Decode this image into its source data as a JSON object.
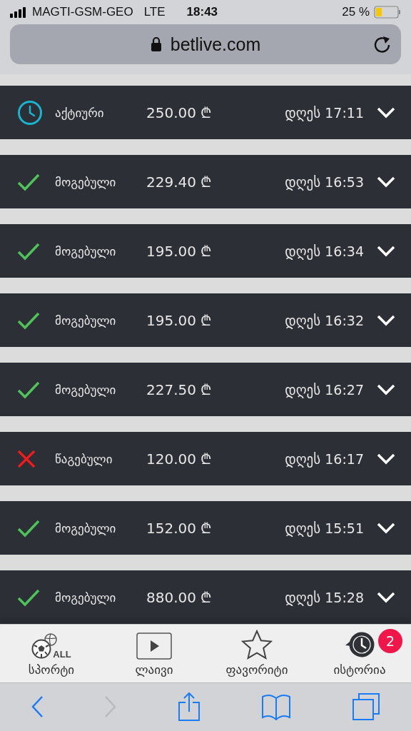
{
  "status_bar": {
    "carrier": "MAGTI-GSM-GEO",
    "network": "LTE",
    "time": "18:43",
    "battery": "25 %"
  },
  "address_bar": {
    "url": "betlive.com"
  },
  "bets": [
    {
      "kind": "active",
      "status": "აქტიური",
      "amount": "250.00 ₾",
      "time": "დღეს 17:11"
    },
    {
      "kind": "won",
      "status": "მოგებული",
      "amount": "229.40 ₾",
      "time": "დღეს 16:53"
    },
    {
      "kind": "won",
      "status": "მოგებული",
      "amount": "195.00 ₾",
      "time": "დღეს 16:34"
    },
    {
      "kind": "won",
      "status": "მოგებული",
      "amount": "195.00 ₾",
      "time": "დღეს 16:32"
    },
    {
      "kind": "won",
      "status": "მოგებული",
      "amount": "227.50 ₾",
      "time": "დღეს 16:27"
    },
    {
      "kind": "lost",
      "status": "წაგებული",
      "amount": "120.00 ₾",
      "time": "დღეს 16:17"
    },
    {
      "kind": "won",
      "status": "მოგებული",
      "amount": "152.00 ₾",
      "time": "დღეს 15:51"
    },
    {
      "kind": "won",
      "status": "მოგებული",
      "amount": "880.00 ₾",
      "time": "დღეს 15:28"
    }
  ],
  "tabs": [
    {
      "kind": "sports",
      "label": "სპორტი",
      "icon_text": "ALL"
    },
    {
      "kind": "live",
      "label": "ლაივი"
    },
    {
      "kind": "favorites",
      "label": "ფავორიტი"
    },
    {
      "kind": "history",
      "label": "ისტორია",
      "badge": "2"
    }
  ],
  "toolbar": [
    {
      "kind": "back",
      "disabled": false
    },
    {
      "kind": "forward",
      "disabled": true
    },
    {
      "kind": "share",
      "disabled": false
    },
    {
      "kind": "bookmarks",
      "disabled": false
    },
    {
      "kind": "tabs",
      "disabled": false
    }
  ]
}
